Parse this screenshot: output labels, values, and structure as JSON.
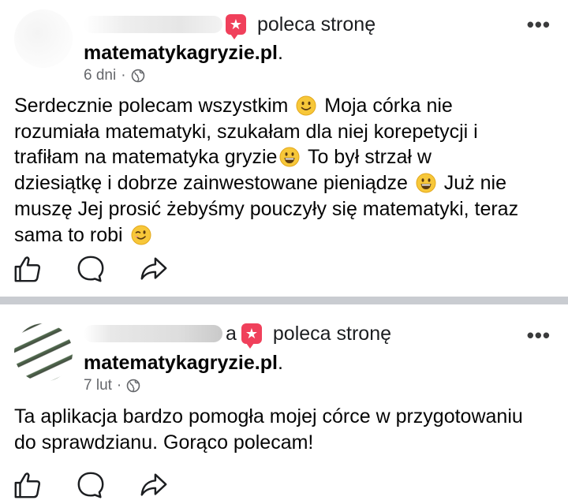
{
  "posts": [
    {
      "recommends_text": "poleca stronę",
      "page_name": "matematykagryzie.pl",
      "page_suffix": ".",
      "time": "6 dni",
      "meta_sep": "·",
      "more": "•••",
      "lines": [
        [
          "Serdecznie polecam wszystkim ",
          " Moja córka nie"
        ],
        [
          "rozumiała matematyki, szukałam dla niej korepetycji i"
        ],
        [
          "trafiłam na matematyka gryzie",
          " To był strzał w"
        ],
        [
          "dziesiątkę i dobrze zainwestowane pieniądze ",
          " Już nie"
        ],
        [
          "muszę Jej prosić żebyśmy pouczyły się matematyki, teraz"
        ],
        [
          "sama to robi "
        ]
      ]
    },
    {
      "recommends_text": "poleca stronę",
      "page_name": "matematykagryzie.pl",
      "page_suffix": ".",
      "time": "7 lut",
      "meta_sep": "·",
      "more": "•••",
      "name_tail": "a",
      "lines": [
        [
          "Ta aplikacja bardzo pomogła mojej córce w przygotowaniu"
        ],
        [
          "do sprawdzianu. Gorąco polecam!"
        ]
      ]
    }
  ],
  "icons": {
    "recommend": "star-badge-icon",
    "privacy": "globe-icon",
    "like": "thumbs-up-icon",
    "comment": "comment-bubble-icon",
    "share": "share-arrow-icon",
    "emoji_smile": "slightly-smiling-face-emoji",
    "emoji_grin": "grinning-face-emoji",
    "emoji_wink": "winking-face-emoji"
  },
  "colors": {
    "badge": "#f0405b",
    "separator": "#c9ccd1",
    "meta_text": "#65676b",
    "emoji_yellow": "#f7c739"
  }
}
